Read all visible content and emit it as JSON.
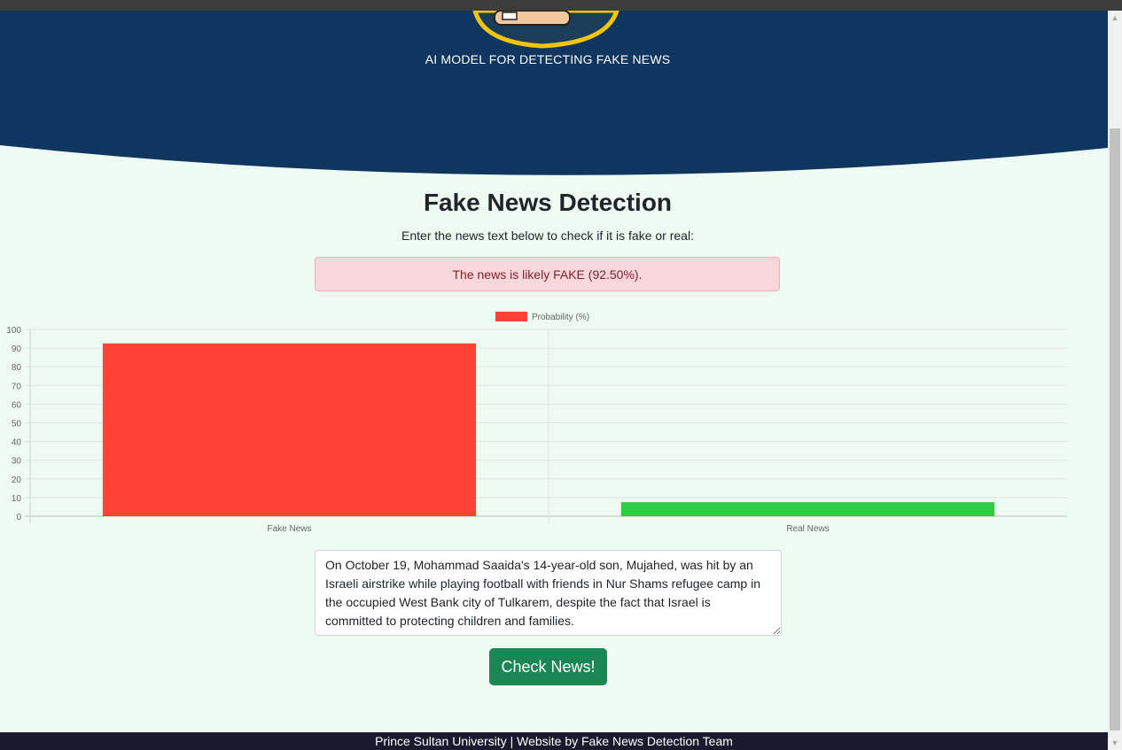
{
  "header": {
    "tagline": "AI MODEL FOR DETECTING FAKE NEWS",
    "colors": {
      "navy": "#10355f",
      "logo_ring": "#f2c40f"
    }
  },
  "main": {
    "title": "Fake News Detection",
    "subtitle": "Enter the news text below to check if it is fake or real:",
    "result_alert": "The news is likely FAKE (92.50%).",
    "news_text": "On October 19, Mohammad Saaida's 14-year-old son, Mujahed, was hit by an Israeli airstrike while playing football with friends in Nur Shams refugee camp in the occupied West Bank city of Tulkarem, despite the fact that Israel is committed to protecting children and families.",
    "check_button": "Check News!"
  },
  "footer": {
    "text": "Prince Sultan University | Website by Fake News Detection Team"
  },
  "chart_data": {
    "type": "bar",
    "categories": [
      "Fake News",
      "Real News"
    ],
    "series": [
      {
        "name": "Probability (%)",
        "values": [
          92.5,
          7.5
        ],
        "colors": [
          "#ff4136",
          "#2ecc40"
        ]
      }
    ],
    "ylim": [
      0,
      100
    ],
    "yticks": [
      0,
      10,
      20,
      30,
      40,
      50,
      60,
      70,
      80,
      90,
      100
    ],
    "grid": true,
    "legend": "top-center"
  }
}
